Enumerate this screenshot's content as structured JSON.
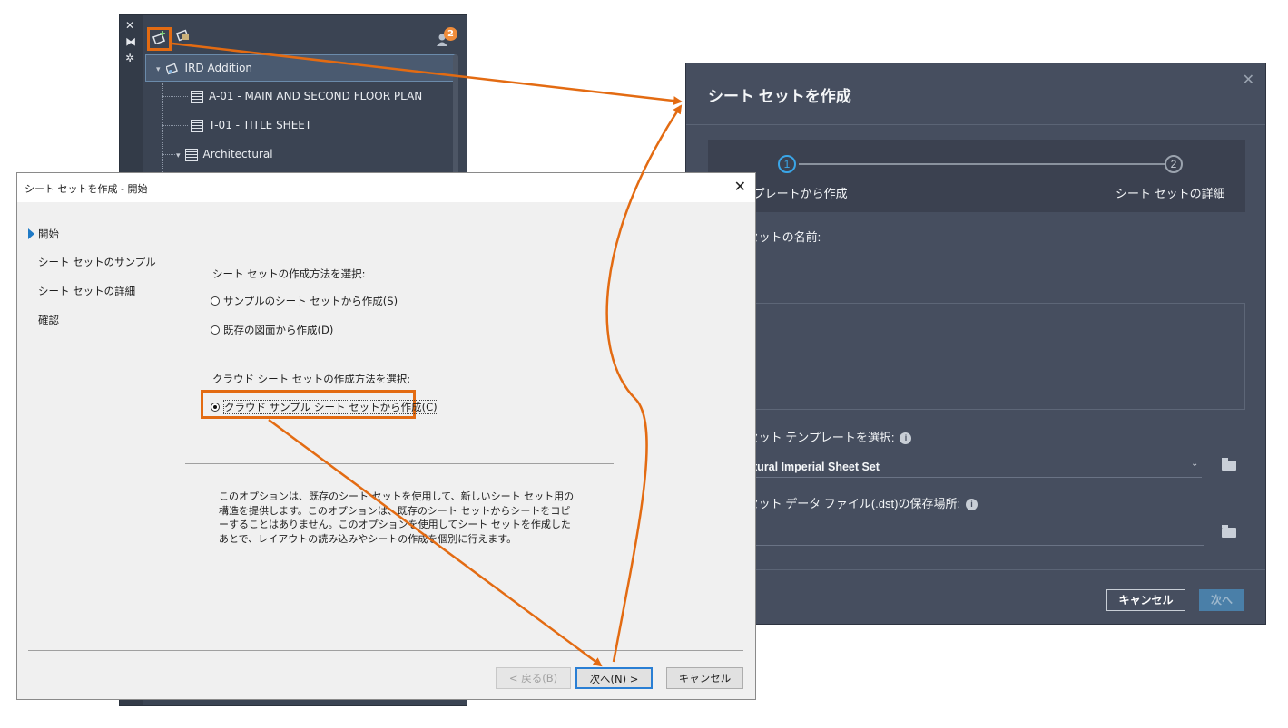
{
  "palette": {
    "strip": {
      "close": "✕",
      "autohide": "⧓",
      "props": "✲"
    },
    "notification_count": "2",
    "tree": {
      "root": "IRD Addition",
      "items": [
        "A-01 - MAIN AND SECOND FLOOR PLAN",
        "T-01 - TITLE SHEET",
        "Architectural"
      ]
    }
  },
  "classic_dialog": {
    "title": "シート セットを作成 - 開始",
    "close": "✕",
    "nav": [
      "開始",
      "シート セットのサンプル",
      "シート セットの詳細",
      "確認"
    ],
    "section1_label": "シート セットの作成方法を選択:",
    "option_sample": "サンプルのシート セットから作成(S)",
    "option_existing": "既存の図面から作成(D)",
    "section2_label": "クラウド シート セットの作成方法を選択:",
    "option_cloud": "クラウド サンプル シート セットから作成(C)",
    "description": "このオプションは、既存のシート セットを使用して、新しいシート セット用の構造を提供します。このオプションは、既存のシート セットからシートをコピーすることはありません。このオプションを使用してシート セットを作成したあとで、レイアウトの読み込みやシートの作成を個別に行えます。",
    "buttons": {
      "back": "< 戻る(B)",
      "next": "次へ(N) >",
      "cancel": "キャンセル"
    }
  },
  "modern_dialog": {
    "title": "シート セットを作成",
    "close": "✕",
    "steps": [
      {
        "number": "1",
        "label": "テンプレートから作成"
      },
      {
        "number": "2",
        "label": "シート セットの詳細"
      }
    ],
    "field_name_label": "シート セットの名前:",
    "field_template_label": "シート セット テンプレートを選択:",
    "template_value": "Architectural Imperial Sheet Set",
    "field_location_label": "シート セット データ ファイル(.dst)の保存場所:",
    "buttons": {
      "cancel": "キャンセル",
      "next": "次へ"
    }
  },
  "colors": {
    "accent_orange": "#e36b12",
    "step_active": "#3aa6e8",
    "palette_bg": "#3b4453",
    "modern_bg": "#464e5f"
  }
}
